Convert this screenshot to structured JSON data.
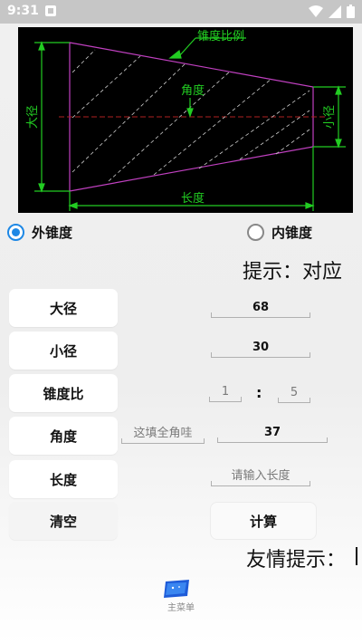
{
  "status_bar": {
    "time": "9:31"
  },
  "diagram": {
    "label_taper_ratio": "锥度比例",
    "label_angle": "角度",
    "label_length": "长度",
    "label_big_diameter": "大径",
    "label_small_diameter": "小径"
  },
  "taper_type": {
    "options": [
      "外锥度",
      "内锥度"
    ],
    "selected": "外锥度"
  },
  "hint_top": "提示：对应",
  "rows": {
    "big_diameter": {
      "label": "大径",
      "value": "68"
    },
    "small_diameter": {
      "label": "小径",
      "value": "30"
    },
    "taper_ratio": {
      "label": "锥度比",
      "left": "1",
      "separator": ":",
      "right": "5"
    },
    "angle": {
      "label": "角度",
      "half_angle_placeholder": "这填全角哇",
      "value": "37"
    },
    "length": {
      "label": "长度",
      "placeholder": "请输入长度"
    }
  },
  "clear_label": "清空",
  "calculate_label": "计算",
  "hint_bottom": "友情提示：",
  "bottom_nav": {
    "label": "主菜单"
  }
}
